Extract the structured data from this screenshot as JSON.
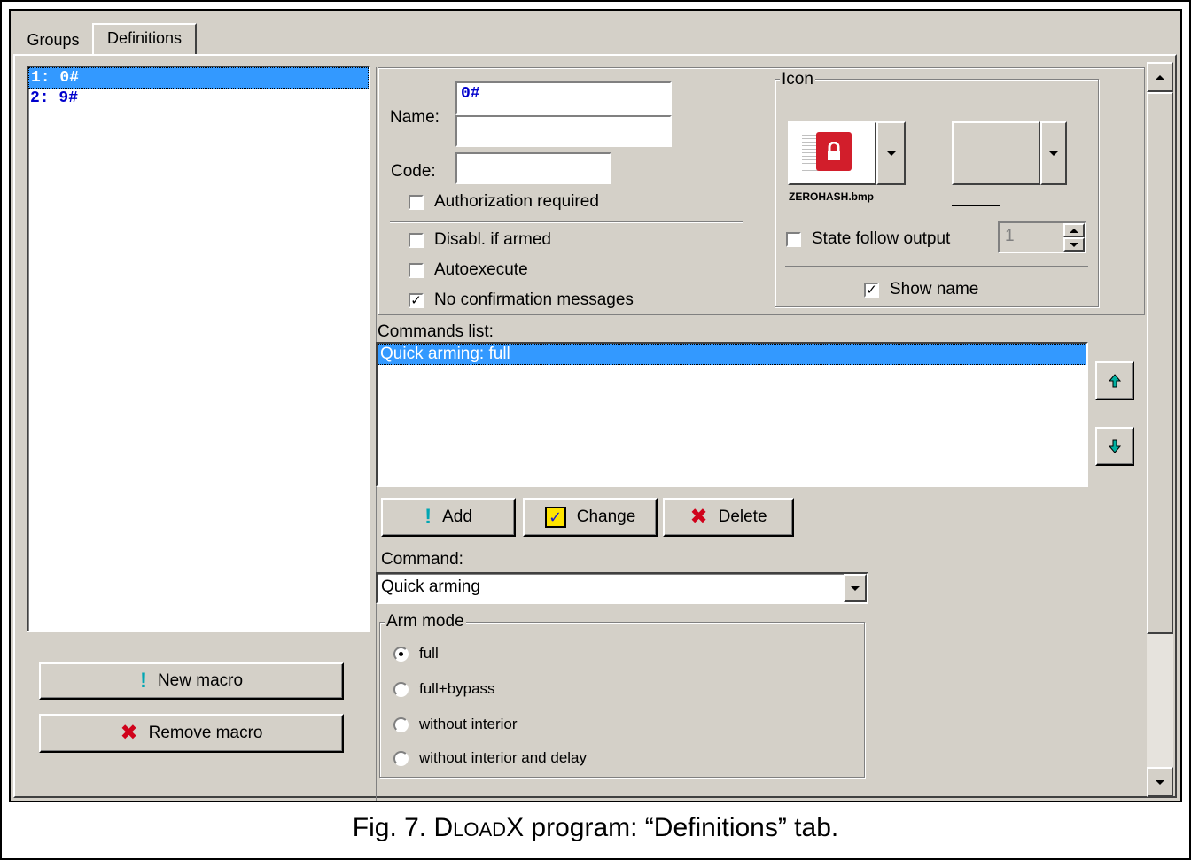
{
  "tabs": [
    "Groups",
    "Definitions"
  ],
  "macro_list": [
    "1: 0#",
    "2: 9#"
  ],
  "buttons": {
    "new_macro": "New macro",
    "remove_macro": "Remove macro",
    "add": "Add",
    "change": "Change",
    "delete": "Delete"
  },
  "form": {
    "name_label": "Name:",
    "name_value": "0#",
    "name_value2": "",
    "code_label": "Code:",
    "code_value": "",
    "authorization_required": {
      "label": "Authorization required",
      "checked": false
    },
    "disabl_if_armed": {
      "label": "Disabl. if armed",
      "checked": false
    },
    "autoexecute": {
      "label": "Autoexecute",
      "checked": false
    },
    "no_confirmation": {
      "label": "No confirmation messages",
      "checked": true
    }
  },
  "icon_group": {
    "legend": "Icon",
    "icon_file": "ZEROHASH.bmp",
    "state_follow_output": {
      "label": "State follow output",
      "checked": false
    },
    "spin_value": "1",
    "show_name": {
      "label": "Show name",
      "checked": true
    }
  },
  "commands": {
    "label": "Commands list:",
    "items": [
      "Quick arming: full"
    ]
  },
  "command": {
    "label": "Command:",
    "value": "Quick arming"
  },
  "arm_mode": {
    "legend": "Arm mode",
    "options": [
      "full",
      "full+bypass",
      "without interior",
      "without interior and delay"
    ],
    "selected": 0
  },
  "caption": {
    "prefix": "Fig. 7. ",
    "d": "D",
    "load": "LOAD",
    "x": "X",
    "rest": " program: “Definitions” tab."
  },
  "colors": {
    "selection": "#3399ff",
    "window": "#d4d0c8",
    "name_text": "#0000cc",
    "delete_x": "#d0021b",
    "add_excl": "#00a6b3",
    "lock_red": "#d21e2b"
  }
}
